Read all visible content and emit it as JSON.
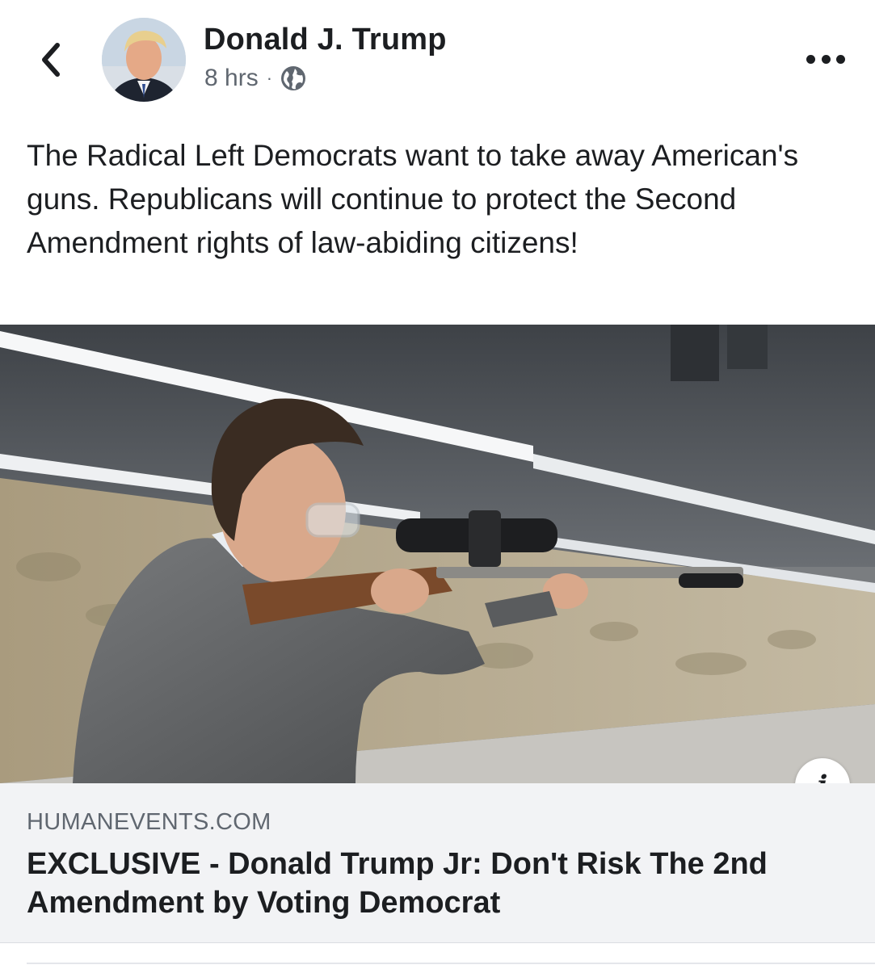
{
  "header": {
    "back_icon": "chevron-left-icon",
    "author": "Donald J. Trump",
    "time": "8 hrs",
    "separator": "·",
    "privacy_icon": "globe-icon",
    "more_icon": "more-horizontal-icon"
  },
  "post": {
    "text": "The Radical Left Democrats want to take away American's guns. Republicans will continue to protect the Second Amendment rights of law-abiding citizens!"
  },
  "link_preview": {
    "info_icon": "info-icon",
    "info_glyph": "i",
    "domain": "HUMANEVENTS.COM",
    "headline": "EXCLUSIVE - Donald Trump Jr: Don't Risk The 2nd Amendment by Voting Democrat"
  },
  "colors": {
    "text_primary": "#1c1e21",
    "text_secondary": "#606770",
    "link_box_bg": "#f2f3f5"
  }
}
